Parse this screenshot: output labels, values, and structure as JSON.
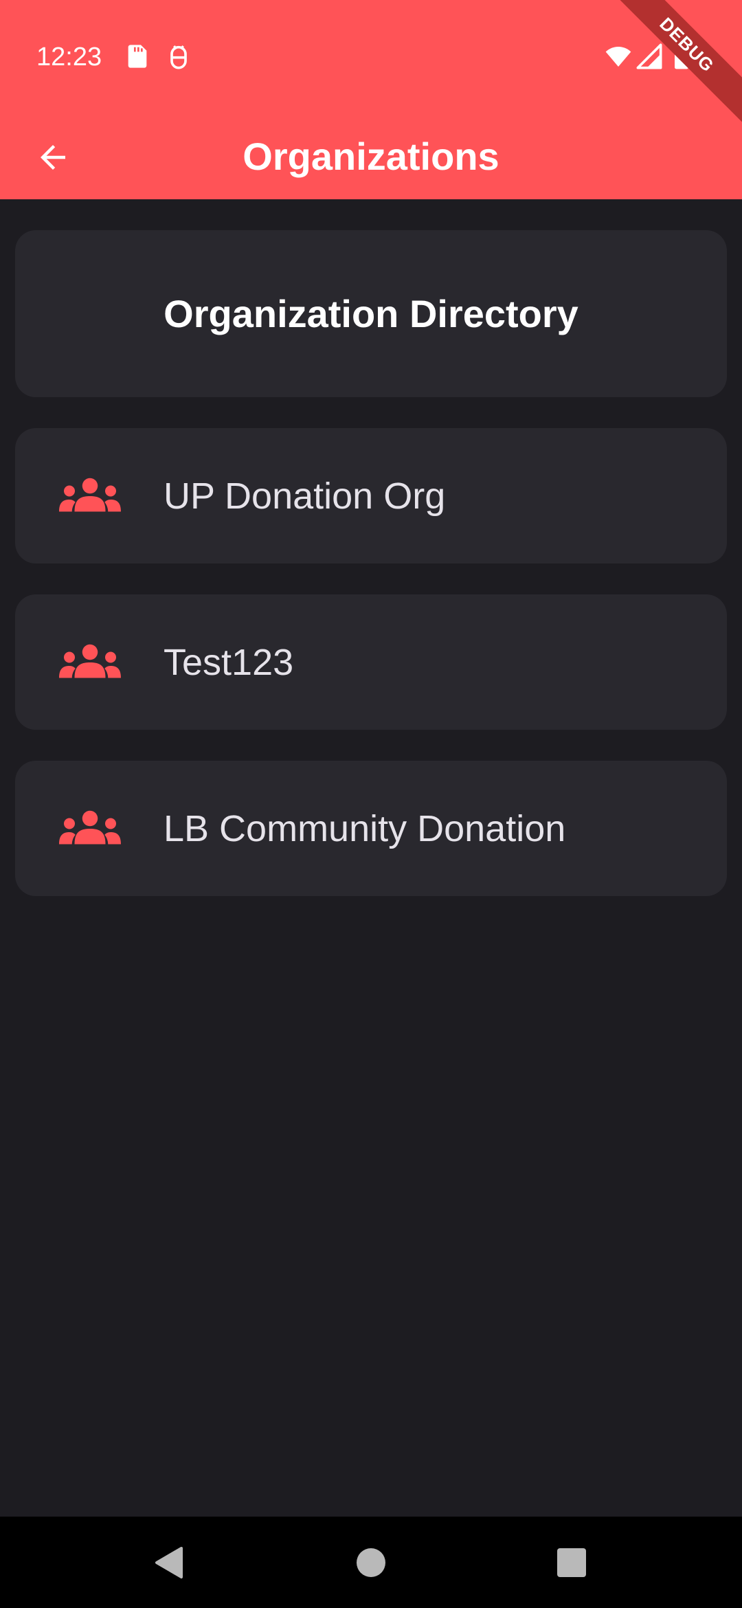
{
  "status_bar": {
    "time": "12:23"
  },
  "app_bar": {
    "title": "Organizations",
    "back_icon": "arrow-back-icon"
  },
  "debug_banner": "DEBUG",
  "directory": {
    "title": "Organization Directory"
  },
  "organizations": [
    {
      "name": "UP Donation Org",
      "icon": "groups-icon"
    },
    {
      "name": "Test123",
      "icon": "groups-icon"
    },
    {
      "name": "LB Community Donation",
      "icon": "groups-icon"
    }
  ],
  "colors": {
    "primary": "#ff5357",
    "background": "#1d1c21",
    "card": "#29282e",
    "text": "#e6e3ea"
  }
}
